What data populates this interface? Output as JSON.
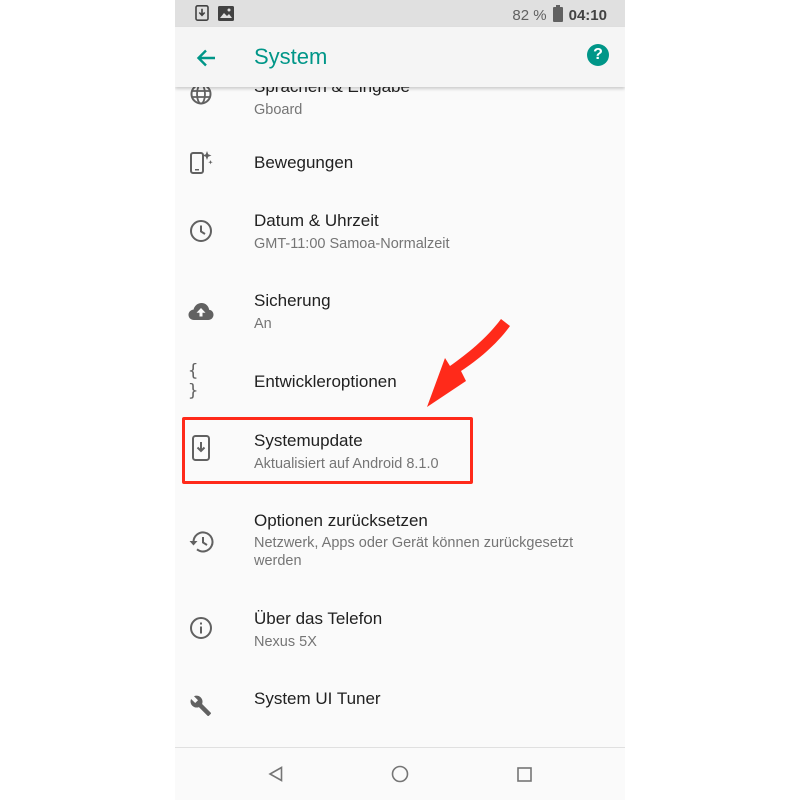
{
  "status_bar": {
    "battery": "82 %",
    "time": "04:10",
    "left_icons": [
      "download-icon",
      "image-icon"
    ]
  },
  "app_bar": {
    "title": "System",
    "back_icon": "arrow-back-icon",
    "help_icon": "help-icon"
  },
  "items": [
    {
      "icon": "globe-icon",
      "title": "Sprachen & Eingabe",
      "subtitle": "Gboard"
    },
    {
      "icon": "gestures-icon",
      "title": "Bewegungen",
      "subtitle": ""
    },
    {
      "icon": "clock-icon",
      "title": "Datum & Uhrzeit",
      "subtitle": "GMT-11:00 Samoa-Normalzeit"
    },
    {
      "icon": "cloud-upload-icon",
      "title": "Sicherung",
      "subtitle": "An"
    },
    {
      "icon": "braces-icon",
      "title": "Entwickleroptionen",
      "subtitle": ""
    },
    {
      "icon": "system-update-icon",
      "title": "Systemupdate",
      "subtitle": "Aktualisiert auf Android 8.1.0"
    },
    {
      "icon": "history-icon",
      "title": "Optionen zurücksetzen",
      "subtitle": "Netzwerk, Apps oder Gerät können zurückgesetzt werden"
    },
    {
      "icon": "info-icon",
      "title": "Über das Telefon",
      "subtitle": "Nexus 5X"
    },
    {
      "icon": "wrench-icon",
      "title": "System UI Tuner",
      "subtitle": ""
    }
  ],
  "nav_bar": {
    "back": "nav-back-icon",
    "home": "nav-home-icon",
    "recents": "nav-recents-icon"
  },
  "annotation": {
    "highlight_color": "#ff2a1a",
    "highlighted_item": "Systemupdate"
  },
  "colors": {
    "accent": "#009688",
    "status_bar": "#e0e0e0",
    "background": "#fafafa"
  }
}
